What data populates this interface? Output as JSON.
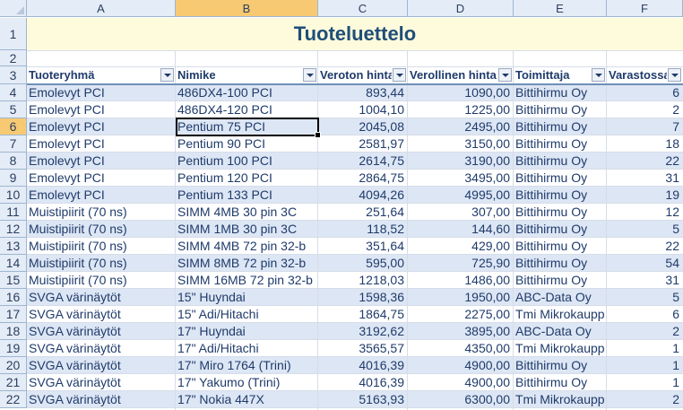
{
  "columns": [
    "A",
    "B",
    "C",
    "D",
    "E",
    "F"
  ],
  "selected_column": "B",
  "selected_row": "6",
  "selected_cell": "B6",
  "title": "Tuoteluettelo",
  "headers": [
    "Tuoteryhmä",
    "Nimike",
    "Veroton hinta",
    "Verollinen hinta",
    "Toimittaja",
    "Varastossa"
  ],
  "rows": [
    {
      "rn": "4",
      "group": "Emolevyt PCI",
      "item": "486DX4-100 PCI",
      "net": "893,44",
      "gross": "1090,00",
      "supplier": "Bittihirmu Oy",
      "stock": "6"
    },
    {
      "rn": "5",
      "group": "Emolevyt PCI",
      "item": "486DX4-120 PCI",
      "net": "1004,10",
      "gross": "1225,00",
      "supplier": "Bittihirmu Oy",
      "stock": "2"
    },
    {
      "rn": "6",
      "group": "Emolevyt PCI",
      "item": "Pentium 75 PCI",
      "net": "2045,08",
      "gross": "2495,00",
      "supplier": "Bittihirmu Oy",
      "stock": "7"
    },
    {
      "rn": "7",
      "group": "Emolevyt PCI",
      "item": "Pentium 90 PCI",
      "net": "2581,97",
      "gross": "3150,00",
      "supplier": "Bittihirmu Oy",
      "stock": "18"
    },
    {
      "rn": "8",
      "group": "Emolevyt PCI",
      "item": "Pentium 100 PCI",
      "net": "2614,75",
      "gross": "3190,00",
      "supplier": "Bittihirmu Oy",
      "stock": "22"
    },
    {
      "rn": "9",
      "group": "Emolevyt PCI",
      "item": "Pentium 120 PCI",
      "net": "2864,75",
      "gross": "3495,00",
      "supplier": "Bittihirmu Oy",
      "stock": "31"
    },
    {
      "rn": "10",
      "group": "Emolevyt PCI",
      "item": "Pentium 133 PCI",
      "net": "4094,26",
      "gross": "4995,00",
      "supplier": "Bittihirmu Oy",
      "stock": "19"
    },
    {
      "rn": "11",
      "group": "Muistipiirit (70 ns)",
      "item": "SIMM 4MB 30 pin 3C",
      "net": "251,64",
      "gross": "307,00",
      "supplier": "Bittihirmu Oy",
      "stock": "12"
    },
    {
      "rn": "12",
      "group": "Muistipiirit (70 ns)",
      "item": "SIMM 1MB 30 pin 3C",
      "net": "118,52",
      "gross": "144,60",
      "supplier": "Bittihirmu Oy",
      "stock": "5"
    },
    {
      "rn": "13",
      "group": "Muistipiirit (70 ns)",
      "item": "SIMM 4MB 72 pin 32-b",
      "net": "351,64",
      "gross": "429,00",
      "supplier": "Bittihirmu Oy",
      "stock": "22"
    },
    {
      "rn": "14",
      "group": "Muistipiirit (70 ns)",
      "item": "SIMM 8MB 72 pin 32-b",
      "net": "595,00",
      "gross": "725,90",
      "supplier": "Bittihirmu Oy",
      "stock": "54"
    },
    {
      "rn": "15",
      "group": "Muistipiirit (70 ns)",
      "item": "SIMM 16MB 72 pin 32-b",
      "net": "1218,03",
      "gross": "1486,00",
      "supplier": "Bittihirmu Oy",
      "stock": "31"
    },
    {
      "rn": "16",
      "group": "SVGA värinäytöt",
      "item": "15\" Huyndai",
      "net": "1598,36",
      "gross": "1950,00",
      "supplier": "ABC-Data Oy",
      "stock": "5"
    },
    {
      "rn": "17",
      "group": "SVGA värinäytöt",
      "item": "15\" Adi/Hitachi",
      "net": "1864,75",
      "gross": "2275,00",
      "supplier": "Tmi Mikrokaupp",
      "stock": "6"
    },
    {
      "rn": "18",
      "group": "SVGA värinäytöt",
      "item": "17\" Huyndai",
      "net": "3192,62",
      "gross": "3895,00",
      "supplier": "ABC-Data Oy",
      "stock": "2"
    },
    {
      "rn": "19",
      "group": "SVGA värinäytöt",
      "item": "17\" Adi/Hitachi",
      "net": "3565,57",
      "gross": "4350,00",
      "supplier": "Tmi Mikrokaupp",
      "stock": "1"
    },
    {
      "rn": "20",
      "group": "SVGA värinäytöt",
      "item": "17\" Miro 1764 (Trini)",
      "net": "4016,39",
      "gross": "4900,00",
      "supplier": "Bittihirmu Oy",
      "stock": "1"
    },
    {
      "rn": "21",
      "group": "SVGA värinäytöt",
      "item": "17\" Yakumo (Trini)",
      "net": "4016,39",
      "gross": "4900,00",
      "supplier": "Bittihirmu Oy",
      "stock": "1"
    },
    {
      "rn": "22",
      "group": "SVGA värinäytöt",
      "item": "17\" Nokia 447X",
      "net": "5163,93",
      "gross": "6300,00",
      "supplier": "Tmi Mikrokaupp",
      "stock": "2"
    }
  ]
}
